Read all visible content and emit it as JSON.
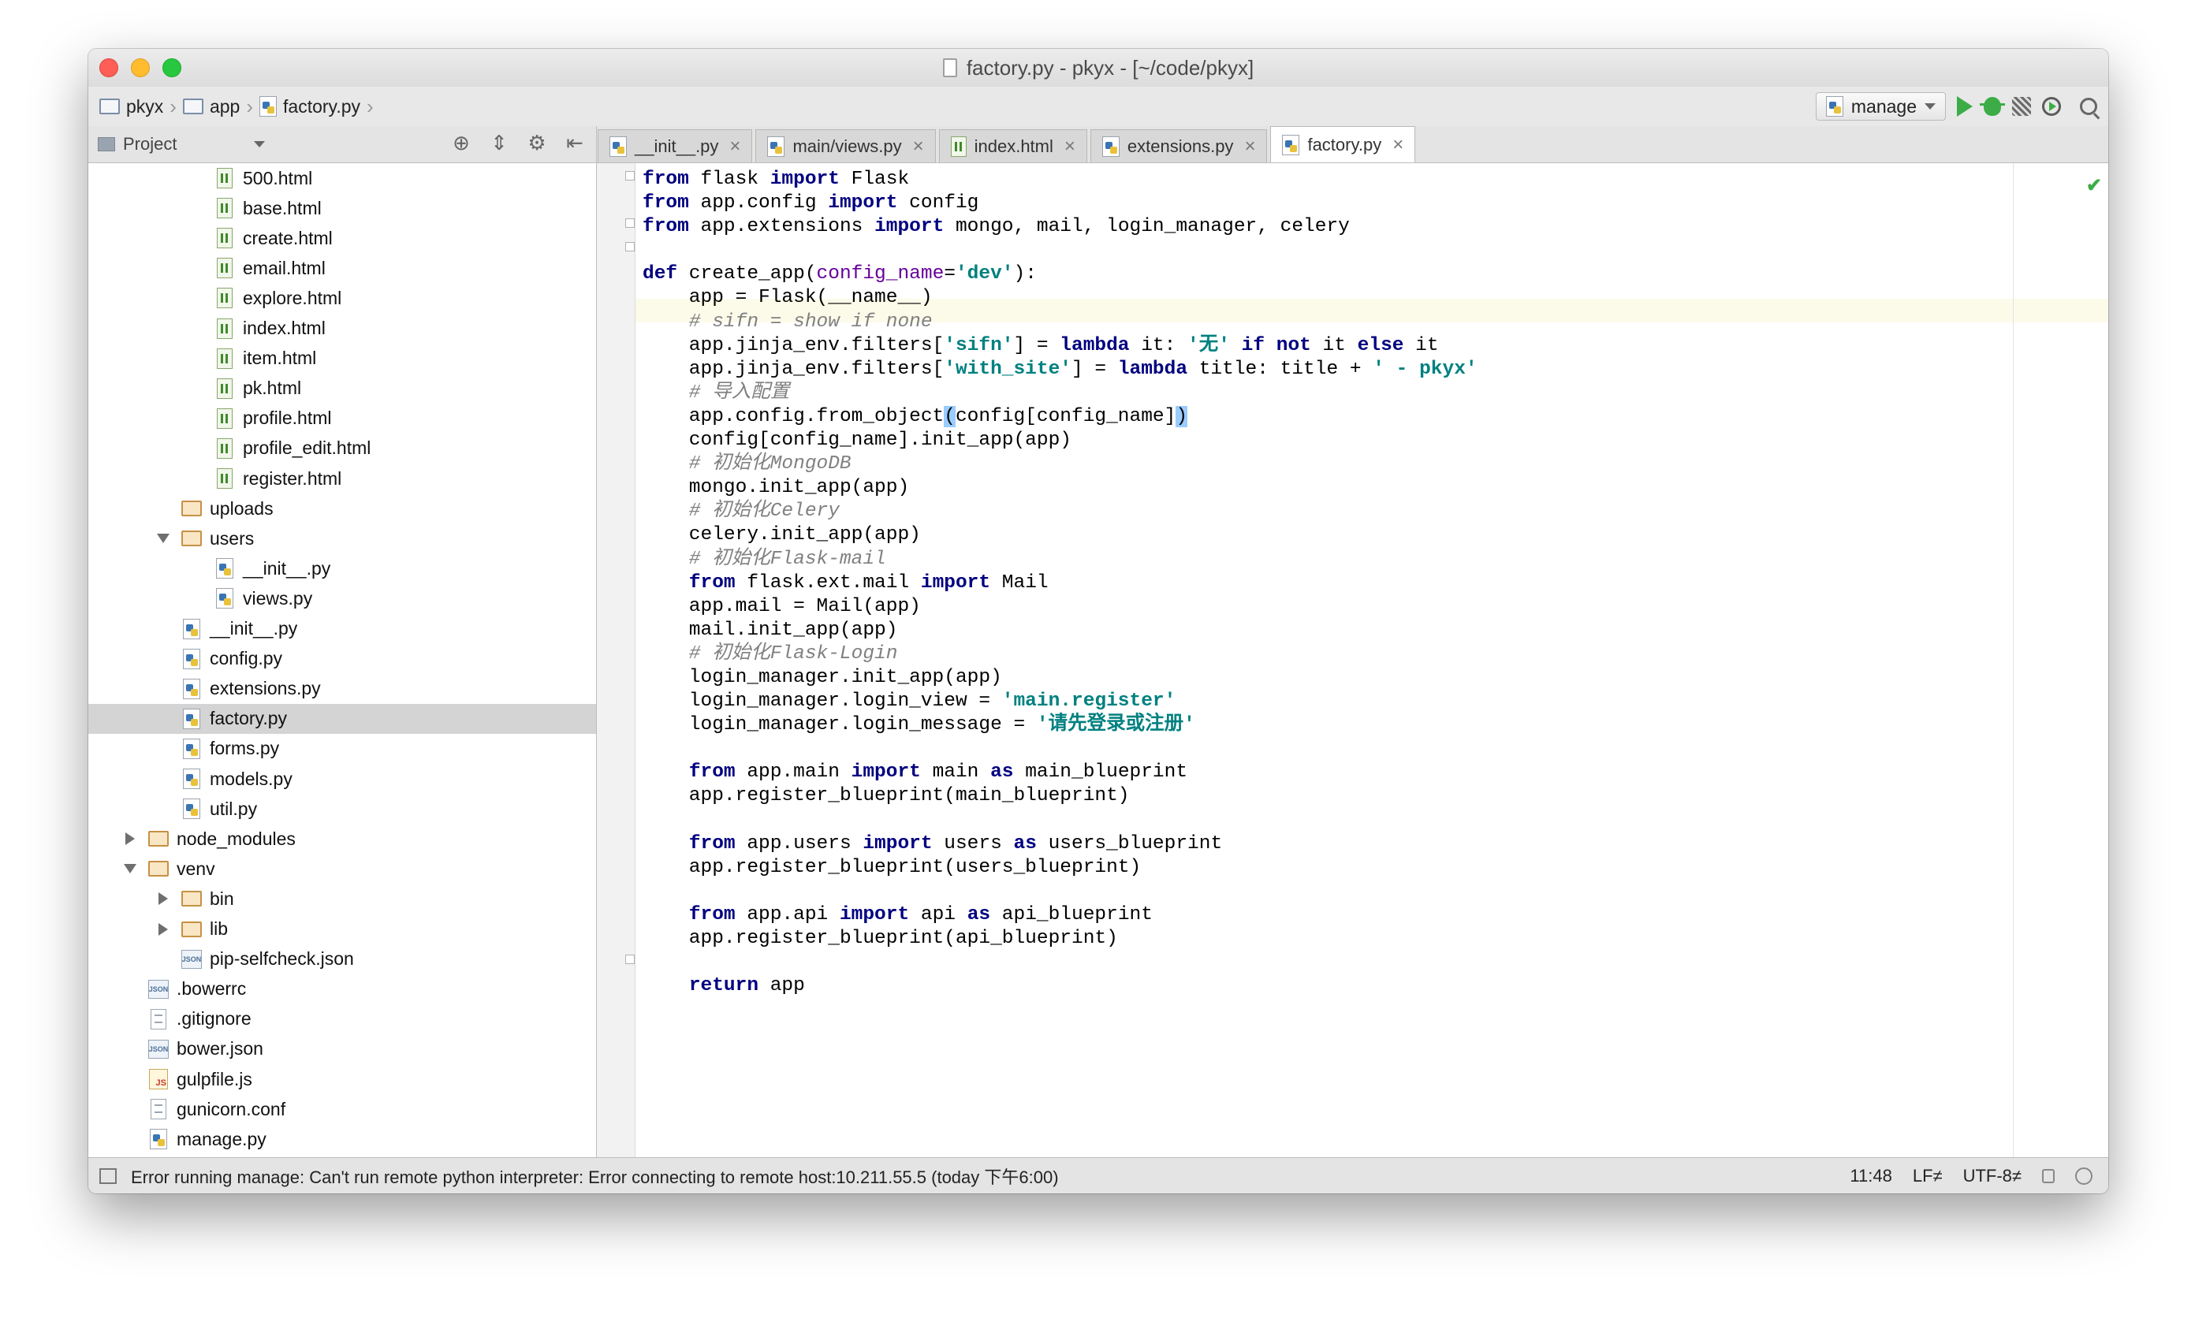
{
  "window": {
    "title": "factory.py - pkyx - [~/code/pkyx]"
  },
  "breadcrumb": [
    {
      "label": "pkyx",
      "icon": "folder-icon"
    },
    {
      "label": "app",
      "icon": "folder-icon"
    },
    {
      "label": "factory.py",
      "icon": "python-file-icon"
    }
  ],
  "run": {
    "config_label": "manage"
  },
  "project_panel": {
    "selector_label": "Project"
  },
  "tabs": [
    {
      "label": "__init__.py",
      "icon": "python-file-icon",
      "active": false
    },
    {
      "label": "main/views.py",
      "icon": "python-file-icon",
      "active": false
    },
    {
      "label": "index.html",
      "icon": "html-file-icon",
      "active": false
    },
    {
      "label": "extensions.py",
      "icon": "python-file-icon",
      "active": false
    },
    {
      "label": "factory.py",
      "icon": "python-file-icon",
      "active": true
    }
  ],
  "tree": [
    {
      "label": "500.html",
      "type": "html",
      "depth": 4
    },
    {
      "label": "base.html",
      "type": "html",
      "depth": 4
    },
    {
      "label": "create.html",
      "type": "html",
      "depth": 4
    },
    {
      "label": "email.html",
      "type": "html",
      "depth": 4
    },
    {
      "label": "explore.html",
      "type": "html",
      "depth": 4
    },
    {
      "label": "index.html",
      "type": "html",
      "depth": 4
    },
    {
      "label": "item.html",
      "type": "html",
      "depth": 4
    },
    {
      "label": "pk.html",
      "type": "html",
      "depth": 4
    },
    {
      "label": "profile.html",
      "type": "html",
      "depth": 4
    },
    {
      "label": "profile_edit.html",
      "type": "html",
      "depth": 4
    },
    {
      "label": "register.html",
      "type": "html",
      "depth": 4
    },
    {
      "label": "uploads",
      "type": "folder",
      "depth": 3,
      "arrow": "none"
    },
    {
      "label": "users",
      "type": "folder",
      "depth": 3,
      "arrow": "down"
    },
    {
      "label": "__init__.py",
      "type": "py",
      "depth": 4
    },
    {
      "label": "views.py",
      "type": "py",
      "depth": 4
    },
    {
      "label": "__init__.py",
      "type": "py",
      "depth": 3
    },
    {
      "label": "config.py",
      "type": "py",
      "depth": 3
    },
    {
      "label": "extensions.py",
      "type": "py",
      "depth": 3
    },
    {
      "label": "factory.py",
      "type": "py",
      "depth": 3,
      "selected": true
    },
    {
      "label": "forms.py",
      "type": "py",
      "depth": 3
    },
    {
      "label": "models.py",
      "type": "py",
      "depth": 3
    },
    {
      "label": "util.py",
      "type": "py",
      "depth": 3
    },
    {
      "label": "node_modules",
      "type": "folder",
      "depth": 2,
      "arrow": "right"
    },
    {
      "label": "venv",
      "type": "folder",
      "depth": 2,
      "arrow": "down"
    },
    {
      "label": "bin",
      "type": "folder",
      "depth": 3,
      "arrow": "right"
    },
    {
      "label": "lib",
      "type": "folder",
      "depth": 3,
      "arrow": "right"
    },
    {
      "label": "pip-selfcheck.json",
      "type": "json",
      "depth": 3
    },
    {
      "label": ".bowerrc",
      "type": "json",
      "depth": 2
    },
    {
      "label": ".gitignore",
      "type": "text",
      "depth": 2
    },
    {
      "label": "bower.json",
      "type": "json",
      "depth": 2
    },
    {
      "label": "gulpfile.js",
      "type": "js",
      "depth": 2
    },
    {
      "label": "gunicorn.conf",
      "type": "text",
      "depth": 2
    },
    {
      "label": "manage.py",
      "type": "py",
      "depth": 2
    }
  ],
  "code": [
    [
      [
        "kw",
        "from"
      ],
      [
        "t",
        " flask "
      ],
      [
        "kw",
        "import"
      ],
      [
        "t",
        " Flask"
      ]
    ],
    [
      [
        "kw",
        "from"
      ],
      [
        "t",
        " app.config "
      ],
      [
        "kw",
        "import"
      ],
      [
        "t",
        " config"
      ]
    ],
    [
      [
        "kw",
        "from"
      ],
      [
        "t",
        " app.extensions "
      ],
      [
        "kw",
        "import"
      ],
      [
        "t",
        " mongo, mail, login_manager, celery"
      ]
    ],
    [],
    [
      [
        "kw",
        "def"
      ],
      [
        "t",
        " create_app("
      ],
      [
        "kwarg",
        "config_name"
      ],
      [
        "t",
        "="
      ],
      [
        "str",
        "'dev'"
      ],
      [
        "t",
        "):"
      ]
    ],
    [
      [
        "t",
        "    app = Flask(__name__)"
      ]
    ],
    [
      [
        "cm",
        "    # sifn = show if none"
      ]
    ],
    [
      [
        "t",
        "    app.jinja_env.filters["
      ],
      [
        "str",
        "'sifn'"
      ],
      [
        "t",
        "] = "
      ],
      [
        "kw",
        "lambda"
      ],
      [
        "t",
        " it: "
      ],
      [
        "str",
        "'无'"
      ],
      [
        "t",
        " "
      ],
      [
        "kw",
        "if"
      ],
      [
        "t",
        " "
      ],
      [
        "kw",
        "not"
      ],
      [
        "t",
        " it "
      ],
      [
        "kw",
        "else"
      ],
      [
        "t",
        " it"
      ]
    ],
    [
      [
        "t",
        "    app.jinja_env.filters["
      ],
      [
        "str",
        "'with_site'"
      ],
      [
        "t",
        "] = "
      ],
      [
        "kw",
        "lambda"
      ],
      [
        "t",
        " title: title + "
      ],
      [
        "str",
        "' - pkyx'"
      ]
    ],
    [
      [
        "cm",
        "    # 导入配置"
      ]
    ],
    [
      [
        "t",
        "    app.config.from_object"
      ],
      [
        "hl",
        "("
      ],
      [
        "t",
        "config[config_name]"
      ],
      [
        "hl",
        ")"
      ]
    ],
    [
      [
        "t",
        "    config[config_name].init_app(app)"
      ]
    ],
    [
      [
        "cm",
        "    # 初始化MongoDB"
      ]
    ],
    [
      [
        "t",
        "    mongo.init_app(app)"
      ]
    ],
    [
      [
        "cm",
        "    # 初始化Celery"
      ]
    ],
    [
      [
        "t",
        "    celery.init_app(app)"
      ]
    ],
    [
      [
        "cm",
        "    # 初始化Flask-mail"
      ]
    ],
    [
      [
        "t",
        "    "
      ],
      [
        "kw",
        "from"
      ],
      [
        "t",
        " flask.ext.mail "
      ],
      [
        "kw",
        "import"
      ],
      [
        "t",
        " Mail"
      ]
    ],
    [
      [
        "t",
        "    app.mail = Mail(app)"
      ]
    ],
    [
      [
        "t",
        "    mail.init_app(app)"
      ]
    ],
    [
      [
        "cm",
        "    # 初始化Flask-Login"
      ]
    ],
    [
      [
        "t",
        "    login_manager.init_app(app)"
      ]
    ],
    [
      [
        "t",
        "    login_manager.login_view = "
      ],
      [
        "str",
        "'main.register'"
      ]
    ],
    [
      [
        "t",
        "    login_manager.login_message = "
      ],
      [
        "str",
        "'请先登录或注册'"
      ]
    ],
    [],
    [
      [
        "t",
        "    "
      ],
      [
        "kw",
        "from"
      ],
      [
        "t",
        " app.main "
      ],
      [
        "kw",
        "import"
      ],
      [
        "t",
        " main "
      ],
      [
        "kw",
        "as"
      ],
      [
        "t",
        " main_blueprint"
      ]
    ],
    [
      [
        "t",
        "    app.register_blueprint(main_blueprint)"
      ]
    ],
    [],
    [
      [
        "t",
        "    "
      ],
      [
        "kw",
        "from"
      ],
      [
        "t",
        " app.users "
      ],
      [
        "kw",
        "import"
      ],
      [
        "t",
        " users "
      ],
      [
        "kw",
        "as"
      ],
      [
        "t",
        " users_blueprint"
      ]
    ],
    [
      [
        "t",
        "    app.register_blueprint(users_blueprint)"
      ]
    ],
    [],
    [
      [
        "t",
        "    "
      ],
      [
        "kw",
        "from"
      ],
      [
        "t",
        " app.api "
      ],
      [
        "kw",
        "import"
      ],
      [
        "t",
        " api "
      ],
      [
        "kw",
        "as"
      ],
      [
        "t",
        " api_blueprint"
      ]
    ],
    [
      [
        "t",
        "    app.register_blueprint(api_blueprint)"
      ]
    ],
    [],
    [
      [
        "t",
        "    "
      ],
      [
        "kw",
        "return"
      ],
      [
        "t",
        " app"
      ]
    ]
  ],
  "status": {
    "message": "Error running manage: Can't run remote python interpreter: Error connecting to remote host:10.211.55.5 (today 下午6:00)",
    "position": "11:48",
    "line_separator": "LF≠",
    "encoding": "UTF-8≠"
  }
}
